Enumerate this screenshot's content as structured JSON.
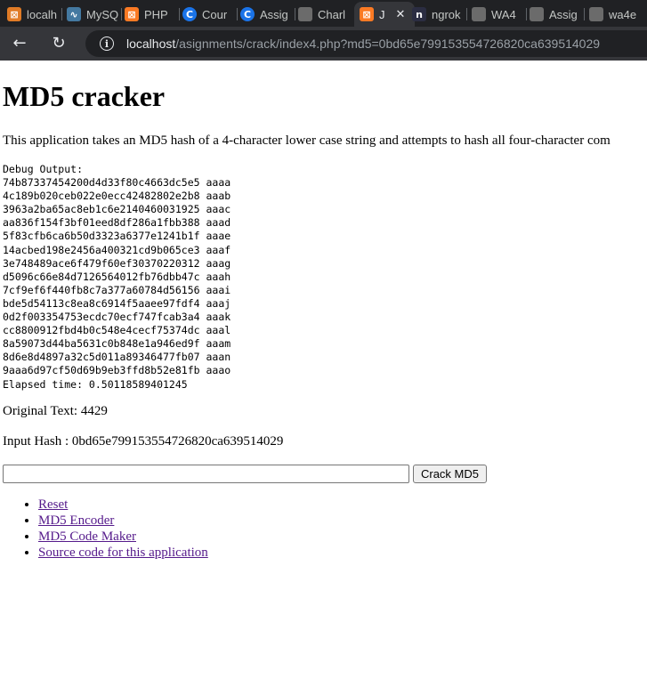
{
  "browser": {
    "tabs": [
      {
        "title": "localh",
        "icon": "xampp-icon",
        "color": "#e07b26"
      },
      {
        "title": "MySQ",
        "icon": "mysql-dolphin-icon",
        "color": "#4479a1"
      },
      {
        "title": "PHP",
        "icon": "xampp-icon",
        "color": "#fb7a24"
      },
      {
        "title": "Cour",
        "icon": "coursera-icon",
        "color": "#1a73e8"
      },
      {
        "title": "Assig",
        "icon": "coursera-icon",
        "color": "#1a73e8"
      },
      {
        "title": "Charl",
        "icon": "site-thumbnail-icon",
        "color": "#6b6b6b"
      },
      {
        "title": "J",
        "icon": "xampp-icon",
        "color": "#fb7a24",
        "active": true
      },
      {
        "title": "ngrok",
        "icon": "ngrok-icon",
        "color": "#2b2d42"
      },
      {
        "title": "WA4",
        "icon": "site-thumbnail-icon",
        "color": "#6b6b6b"
      },
      {
        "title": "Assig",
        "icon": "site-thumbnail-icon",
        "color": "#6b6b6b"
      },
      {
        "title": "wa4e",
        "icon": "site-thumbnail-icon",
        "color": "#6b6b6b"
      }
    ],
    "url_host": "localhost",
    "url_path": "/asignments/crack/index4.php?md5=0bd65e799153554726820ca639514029"
  },
  "page": {
    "title": "MD5 cracker",
    "intro": "This application takes an MD5 hash of a 4-character lower case string and attempts to hash all four-character com",
    "debug_label": "Debug Output:",
    "debug_lines": [
      "74b87337454200d4d33f80c4663dc5e5 aaaa",
      "4c189b020ceb022e0ecc42482802e2b8 aaab",
      "3963a2ba65ac8eb1c6e2140460031925 aaac",
      "aa836f154f3bf01eed8df286a1fbb388 aaad",
      "5f83cfb6ca6b50d3323a6377e1241b1f aaae",
      "14acbed198e2456a400321cd9b065ce3 aaaf",
      "3e748489ace6f479f60ef30370220312 aaag",
      "d5096c66e84d7126564012fb76dbb47c aaah",
      "7cf9ef6f440fb8c7a377a60784d56156 aaai",
      "bde5d54113c8ea8c6914f5aaee97fdf4 aaaj",
      "0d2f003354753ecdc70ecf747fcab3a4 aaak",
      "cc8800912fbd4b0c548e4cecf75374dc aaal",
      "8a59073d44ba5631c0b848e1a946ed9f aaam",
      "8d6e8d4897a32c5d011a89346477fb07 aaan",
      "9aaa6d97cf50d69b9eb3ffd8b52e81fb aaao"
    ],
    "elapsed": "Elapsed time: 0.50118589401245",
    "original_text": "Original Text: 4429",
    "input_hash": "Input Hash : 0bd65e799153554726820ca639514029",
    "md5_input_value": "",
    "crack_button": "Crack MD5",
    "links": [
      "Reset",
      "MD5 Encoder",
      "MD5 Code Maker",
      "Source code for this application"
    ]
  }
}
